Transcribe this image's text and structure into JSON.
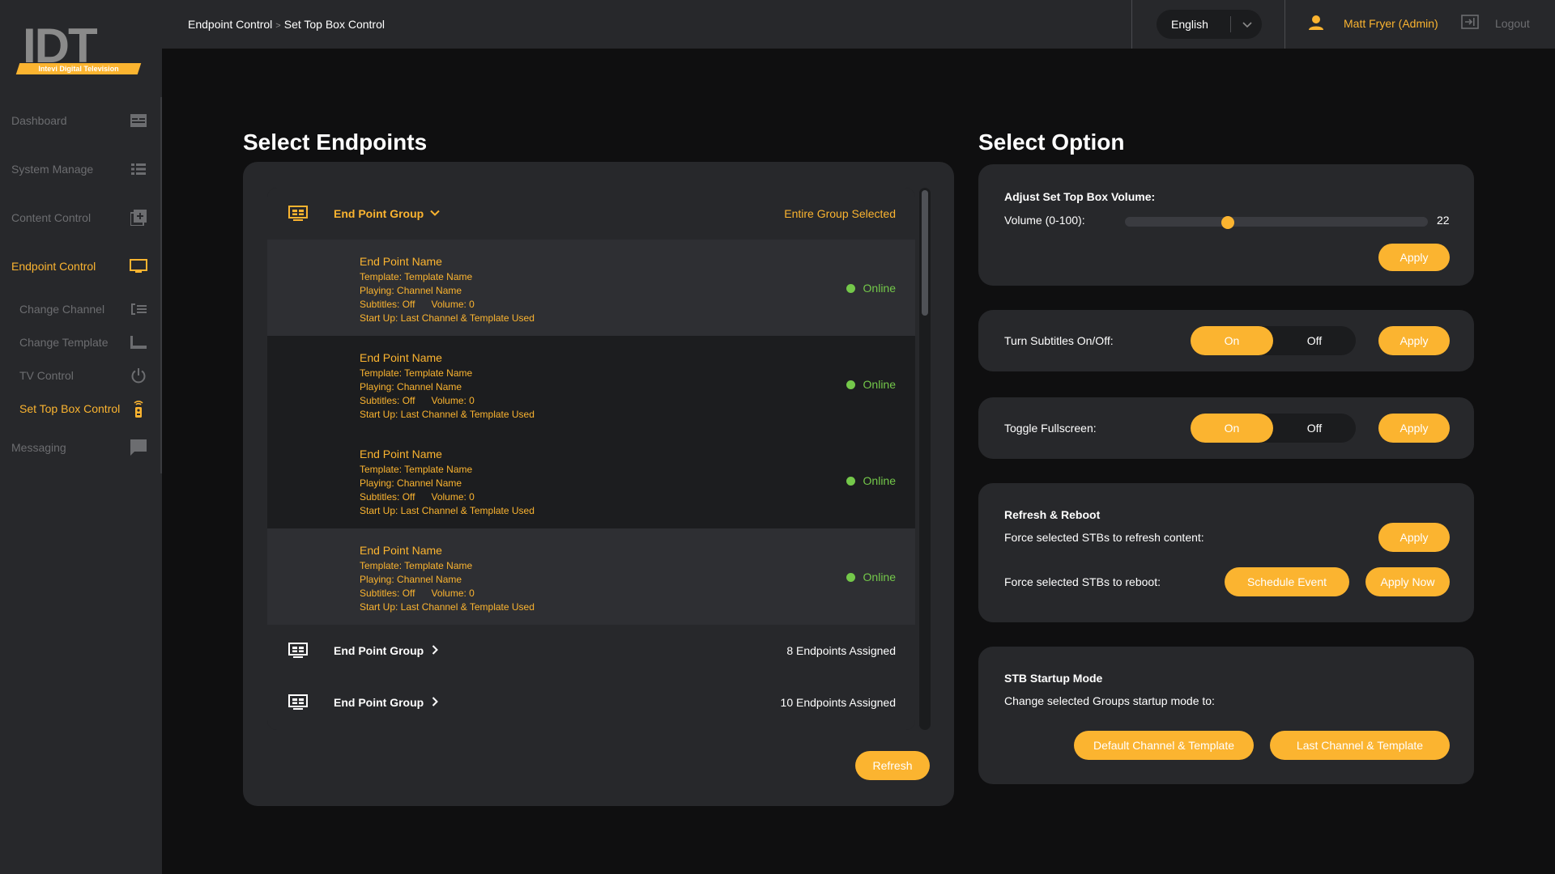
{
  "app": {
    "logo_text": "IDT",
    "logo_tagline": "Intevi Digital Television",
    "brand_color": "#fbb430"
  },
  "sidebar": {
    "items": [
      {
        "label": "Dashboard",
        "icon": "dashboard-icon"
      },
      {
        "label": "System Manage",
        "icon": "list-icon"
      },
      {
        "label": "Content Control",
        "icon": "add-content-icon"
      },
      {
        "label": "Endpoint Control",
        "icon": "monitor-icon",
        "active": true
      }
    ],
    "sub_items": [
      {
        "label": "Change Channel",
        "icon": "channel-list-icon"
      },
      {
        "label": "Change Template",
        "icon": "template-icon"
      },
      {
        "label": "TV Control",
        "icon": "power-icon"
      },
      {
        "label": "Set Top Box Control",
        "icon": "remote-icon",
        "active": true
      }
    ],
    "messaging": {
      "label": "Messaging",
      "icon": "chat-icon"
    }
  },
  "header": {
    "breadcrumb": [
      "Endpoint Control",
      "Set Top Box Control"
    ],
    "breadcrumb_sep": ">",
    "language": "English",
    "user": "Matt Fryer (Admin)",
    "logout": "Logout"
  },
  "endpoints": {
    "title": "Select Endpoints",
    "groups": [
      {
        "name": "End Point Group",
        "status": "Entire Group Selected",
        "expanded": true
      },
      {
        "name": "End Point Group",
        "status": "8 Endpoints Assigned",
        "expanded": false
      },
      {
        "name": "End Point Group",
        "status": "10 Endpoints Assigned",
        "expanded": false
      }
    ],
    "items": [
      {
        "name": "End Point Name",
        "template": "Template: Template Name",
        "playing": "Playing: Channel Name",
        "subtitles": "Subtitles: Off",
        "volume": "Volume: 0",
        "startup": "Start Up: Last Channel & Template Used",
        "status": "Online"
      },
      {
        "name": "End Point Name",
        "template": "Template: Template Name",
        "playing": "Playing: Channel Name",
        "subtitles": "Subtitles: Off",
        "volume": "Volume: 0",
        "startup": "Start Up: Last Channel & Template Used",
        "status": "Online"
      },
      {
        "name": "End Point Name",
        "template": "Template: Template Name",
        "playing": "Playing: Channel Name",
        "subtitles": "Subtitles: Off",
        "volume": "Volume: 0",
        "startup": "Start Up: Last Channel & Template Used",
        "status": "Online"
      },
      {
        "name": "End Point Name",
        "template": "Template: Template Name",
        "playing": "Playing: Channel Name",
        "subtitles": "Subtitles: Off",
        "volume": "Volume: 0",
        "startup": "Start Up: Last Channel & Template Used",
        "status": "Online"
      }
    ],
    "status_color": "#74c84a",
    "refresh_label": "Refresh"
  },
  "options": {
    "title": "Select Option",
    "volume": {
      "heading": "Adjust Set Top Box Volume:",
      "label": "Volume (0-100):",
      "value": 22,
      "value_text": "22",
      "max": 100,
      "apply": "Apply"
    },
    "subtitles": {
      "label": "Turn Subtitles On/Off:",
      "on": "On",
      "off": "Off",
      "apply": "Apply"
    },
    "fullscreen": {
      "label": "Toggle Fullscreen:",
      "on": "On",
      "off": "Off",
      "apply": "Apply"
    },
    "refresh_reboot": {
      "heading": "Refresh & Reboot",
      "refresh_label": "Force selected STBs to refresh content:",
      "refresh_apply": "Apply",
      "reboot_label": "Force selected STBs to reboot:",
      "schedule": "Schedule Event",
      "apply_now": "Apply Now"
    },
    "startup": {
      "heading": "STB Startup Mode",
      "label": "Change selected Groups startup mode to:",
      "default_btn": "Default Channel & Template",
      "last_btn": "Last Channel & Template"
    }
  }
}
